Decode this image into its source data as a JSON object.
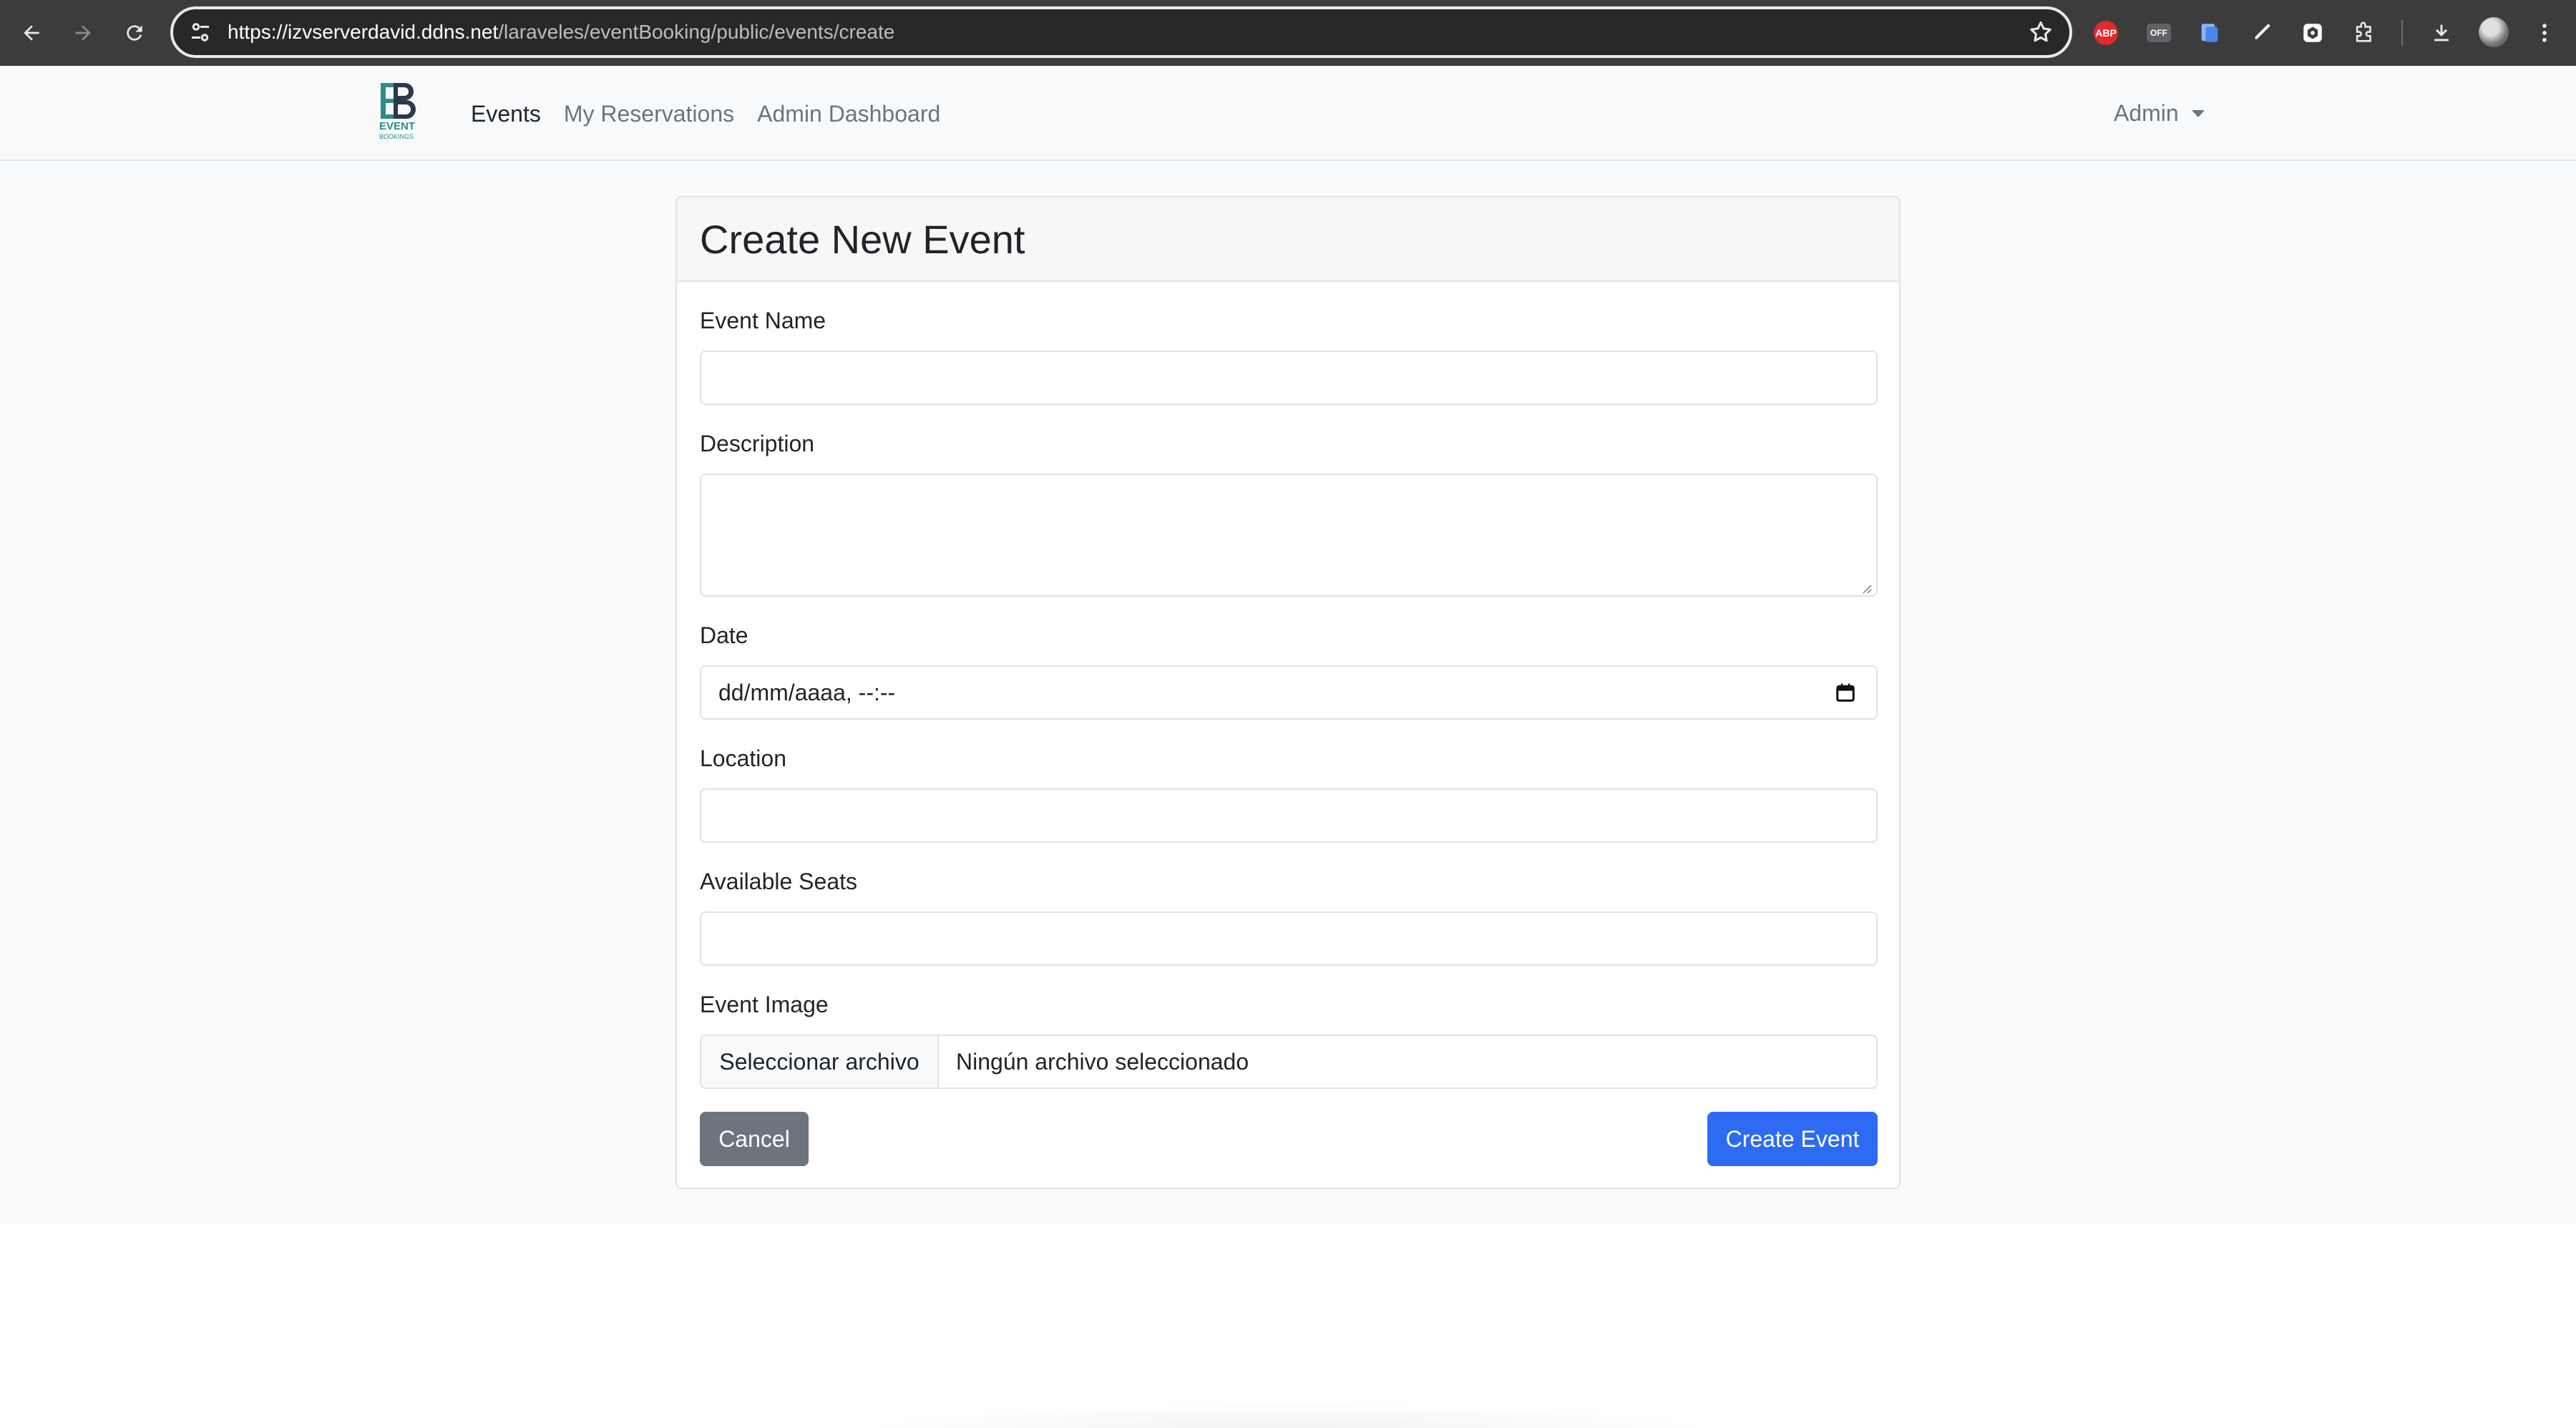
{
  "browser": {
    "url_host": "https://izvserverdavid.ddns.net",
    "url_path": "/laraveles/eventBooking/public/events/create",
    "extensions": {
      "abp_label": "ABP",
      "off_label": "OFF"
    }
  },
  "navbar": {
    "brand_line1": "EVENT",
    "brand_line2": "BOOKINGS",
    "links": [
      "Events",
      "My Reservations",
      "Admin Dashboard"
    ],
    "user": "Admin"
  },
  "form": {
    "title": "Create New Event",
    "event_name_label": "Event Name",
    "description_label": "Description",
    "date_label": "Date",
    "date_placeholder": "dd/mm/aaaa, --:--",
    "location_label": "Location",
    "seats_label": "Available Seats",
    "image_label": "Event Image",
    "file_button": "Seleccionar archivo",
    "file_none": "Ningún archivo seleccionado",
    "cancel": "Cancel",
    "submit": "Create Event"
  },
  "colors": {
    "primary": "#2d6bf5",
    "secondary": "#6c757d",
    "brand_teal": "#2a8f8a"
  }
}
